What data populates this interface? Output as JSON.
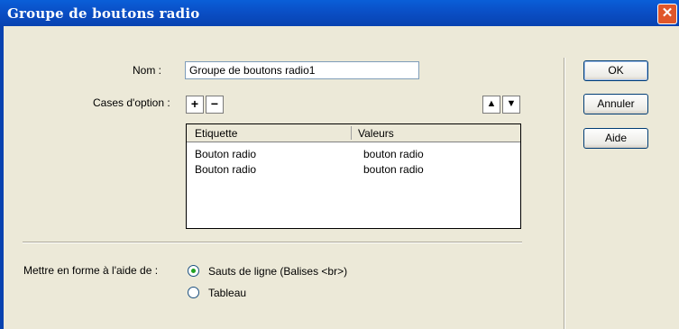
{
  "window": {
    "title": "Groupe de boutons radio",
    "close_glyph": "✕"
  },
  "name": {
    "label": "Nom :",
    "value": "Groupe de boutons radio1"
  },
  "options": {
    "label": "Cases d'option :",
    "add_glyph": "+",
    "remove_glyph": "−",
    "up_glyph": "▲",
    "down_glyph": "▼"
  },
  "table": {
    "headers": [
      "Etiquette",
      "Valeurs"
    ],
    "rows": [
      [
        "Bouton radio",
        "bouton radio"
      ],
      [
        "Bouton radio",
        "bouton radio"
      ]
    ]
  },
  "format": {
    "label": "Mettre en forme à l'aide de :",
    "options": [
      {
        "label": "Sauts de ligne (Balises <br>)",
        "selected": true
      },
      {
        "label": "Tableau",
        "selected": false
      }
    ]
  },
  "buttons": {
    "ok": "OK",
    "cancel": "Annuler",
    "help": "Aide"
  }
}
